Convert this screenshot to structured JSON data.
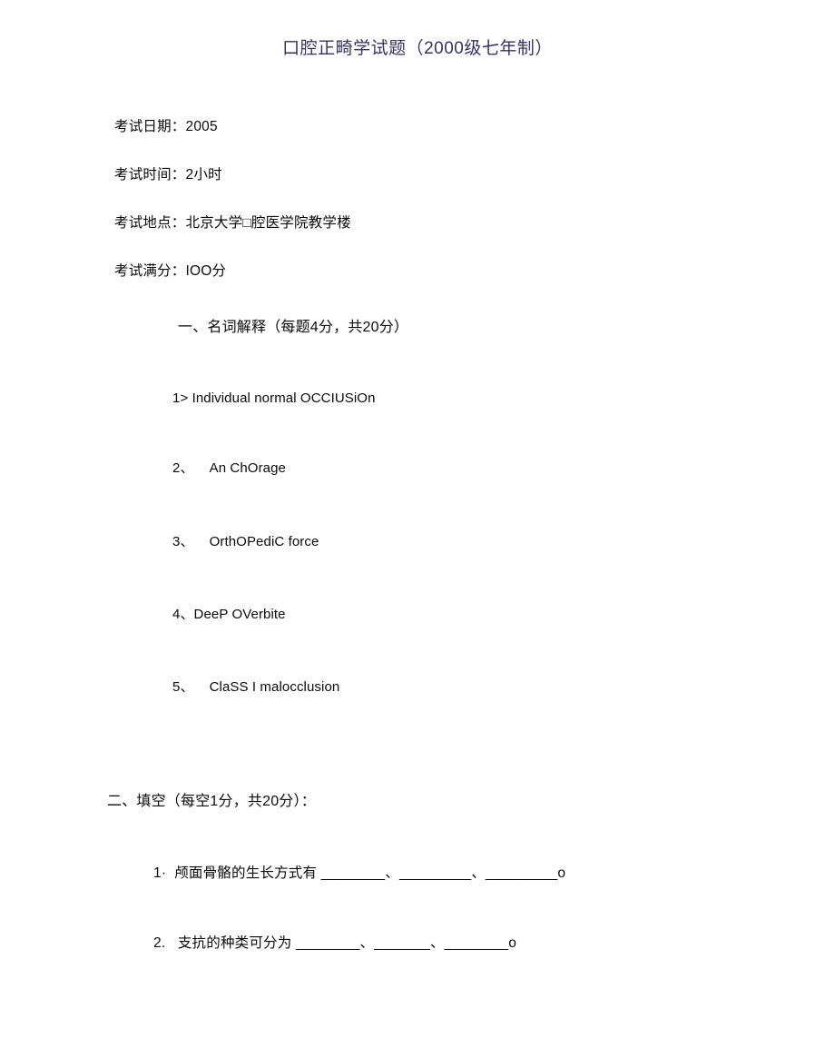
{
  "document": {
    "title": "口腔正畸学试题（2000级七年制）",
    "title_color": "#333366",
    "background_color": "#ffffff",
    "text_color": "#0a0a0a"
  },
  "meta": {
    "exam_date": "考试日期：2005",
    "exam_duration": "考试时间：2小时",
    "exam_location": "考试地点：北京大学□腔医学院教学楼",
    "exam_total_score": "考试满分：IOO分"
  },
  "sections": [
    {
      "heading": "一、名词解释（每题4分，共20分）",
      "items": [
        "1> Individual normal OCCIUSiOn",
        "2、    An ChOrage",
        "3、    OrthOPediC force",
        "4、DeeP OVerbite",
        "5、    ClaSS I malocclusion"
      ]
    },
    {
      "heading": "二、填空（每空1分，共20分）：",
      "items": [
        "1·  颅面骨骼的生长方式有 ________、_________、_________o",
        "2.   支抗的种类可分为 ________、_______、________o"
      ]
    }
  ]
}
